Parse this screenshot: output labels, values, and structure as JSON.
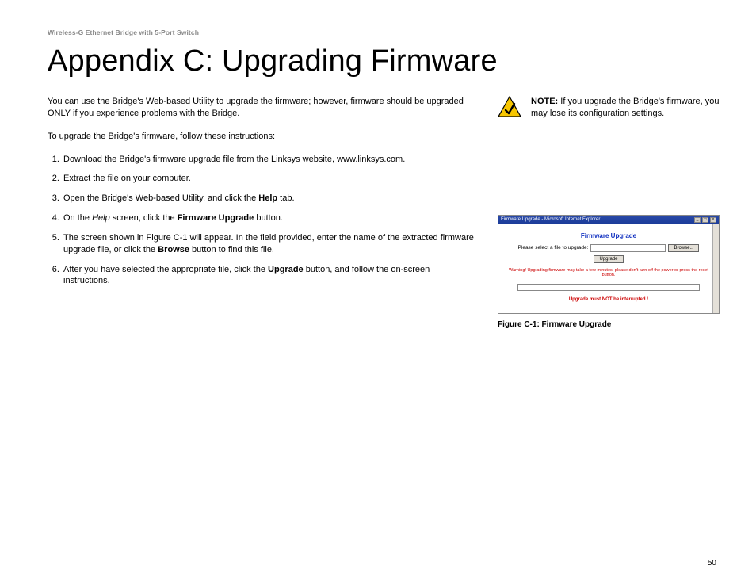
{
  "header": "Wireless-G Ethernet Bridge with 5-Port Switch",
  "title": "Appendix C: Upgrading Firmware",
  "intro1": "You can use the Bridge's Web-based Utility to upgrade the firmware; however, firmware should be upgraded ONLY if you experience problems with the Bridge.",
  "intro2": "To upgrade the Bridge's firmware, follow these instructions:",
  "steps": {
    "s1": "Download the Bridge's firmware upgrade file from the Linksys website, www.linksys.com.",
    "s2": "Extract the file on your computer.",
    "s3a": "Open the Bridge's Web-based Utility, and click the ",
    "s3b": "Help",
    "s3c": " tab.",
    "s4a": "On the ",
    "s4b": "Help",
    "s4c": " screen, click the ",
    "s4d": "Firmware Upgrade",
    "s4e": " button.",
    "s5a": "The screen shown in Figure C-1 will appear. In the field provided, enter the name of the extracted firmware upgrade file, or click the ",
    "s5b": "Browse",
    "s5c": " button to find this file.",
    "s6a": "After you have selected the appropriate file, click the ",
    "s6b": "Upgrade",
    "s6c": " button, and follow the on-screen instructions."
  },
  "note": {
    "label": "NOTE:",
    "text": "  If you upgrade the Bridge's firmware, you may lose its configuration settings."
  },
  "figure": {
    "window_title": "Firmware Upgrade - Microsoft Internet Explorer",
    "heading": "Firmware Upgrade",
    "prompt": "Please select a file to upgrade:",
    "browse": "Browse...",
    "upgrade": "Upgrade",
    "warn1": "Warning! Upgrading firmware may take a few minutes, please don't turn off the power or press the reset button.",
    "warn2": "Upgrade must NOT be interrupted !",
    "caption": "Figure C-1: Firmware Upgrade"
  },
  "page_number": "50"
}
